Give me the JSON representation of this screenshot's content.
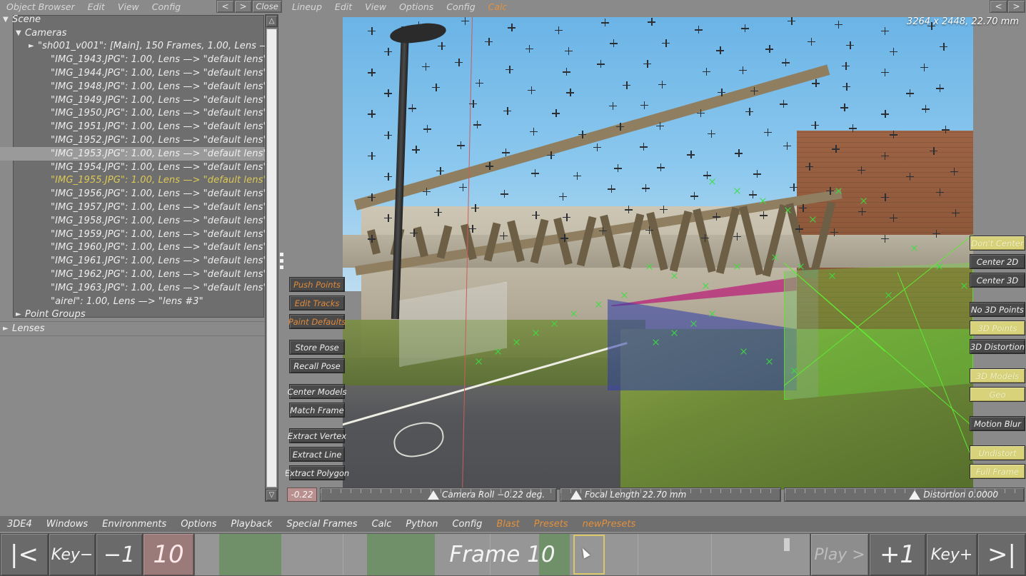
{
  "object_browser": {
    "menu": [
      "Object Browser",
      "Edit",
      "View",
      "Config"
    ],
    "nav_prev": "<",
    "nav_next": ">",
    "close_label": "Close",
    "tree": [
      {
        "label": "Scene",
        "indent": 0,
        "arrow": "down",
        "state": "normal"
      },
      {
        "label": "Cameras",
        "indent": 1,
        "arrow": "down",
        "state": "normal"
      },
      {
        "label": "\"sh001_v001\":  [Main], 150 Frames, 1.00, Lens —",
        "indent": 2,
        "arrow": "right",
        "state": "normal"
      },
      {
        "label": "\"IMG_1943.JPG\":  1.00, Lens —> \"default lens\"",
        "indent": 3,
        "arrow": "none",
        "state": "normal"
      },
      {
        "label": "\"IMG_1944.JPG\":  1.00, Lens —> \"default lens\"",
        "indent": 3,
        "arrow": "none",
        "state": "normal"
      },
      {
        "label": "\"IMG_1948.JPG\":  1.00, Lens —> \"default lens\"",
        "indent": 3,
        "arrow": "none",
        "state": "normal"
      },
      {
        "label": "\"IMG_1949.JPG\":  1.00, Lens —> \"default lens\"",
        "indent": 3,
        "arrow": "none",
        "state": "normal"
      },
      {
        "label": "\"IMG_1950.JPG\":  1.00, Lens —> \"default lens\"",
        "indent": 3,
        "arrow": "none",
        "state": "normal"
      },
      {
        "label": "\"IMG_1951.JPG\":  1.00, Lens —> \"default lens\"",
        "indent": 3,
        "arrow": "none",
        "state": "normal"
      },
      {
        "label": "\"IMG_1952.JPG\":  1.00, Lens —> \"default lens\"",
        "indent": 3,
        "arrow": "none",
        "state": "normal"
      },
      {
        "label": "\"IMG_1953.JPG\":  1.00, Lens —> \"default lens\"",
        "indent": 3,
        "arrow": "none",
        "state": "selected"
      },
      {
        "label": "\"IMG_1954.JPG\":  1.00, Lens —> \"default lens\"",
        "indent": 3,
        "arrow": "none",
        "state": "normal"
      },
      {
        "label": "\"IMG_1955.JPG\":  1.00, Lens —> \"default lens\"",
        "indent": 3,
        "arrow": "none",
        "state": "highlight"
      },
      {
        "label": "\"IMG_1956.JPG\":  1.00, Lens —> \"default lens\"",
        "indent": 3,
        "arrow": "none",
        "state": "normal"
      },
      {
        "label": "\"IMG_1957.JPG\":  1.00, Lens —> \"default lens\"",
        "indent": 3,
        "arrow": "none",
        "state": "normal"
      },
      {
        "label": "\"IMG_1958.JPG\":  1.00, Lens —> \"default lens\"",
        "indent": 3,
        "arrow": "none",
        "state": "normal"
      },
      {
        "label": "\"IMG_1959.JPG\":  1.00, Lens —> \"default lens\"",
        "indent": 3,
        "arrow": "none",
        "state": "normal"
      },
      {
        "label": "\"IMG_1960.JPG\":  1.00, Lens —> \"default lens\"",
        "indent": 3,
        "arrow": "none",
        "state": "normal"
      },
      {
        "label": "\"IMG_1961.JPG\":  1.00, Lens —> \"default lens\"",
        "indent": 3,
        "arrow": "none",
        "state": "normal"
      },
      {
        "label": "\"IMG_1962.JPG\":  1.00, Lens —> \"default lens\"",
        "indent": 3,
        "arrow": "none",
        "state": "normal"
      },
      {
        "label": "\"IMG_1963.JPG\":  1.00, Lens —> \"default lens\"",
        "indent": 3,
        "arrow": "none",
        "state": "normal"
      },
      {
        "label": "\"airel\":  1.00, Lens —> \"lens #3\"",
        "indent": 3,
        "arrow": "none",
        "state": "normal"
      },
      {
        "label": "Point Groups",
        "indent": 1,
        "arrow": "right",
        "state": "normal"
      },
      {
        "label": "Lenses",
        "indent": 0,
        "arrow": "right",
        "state": "normal"
      }
    ]
  },
  "viewport": {
    "menu": [
      "Lineup",
      "Edit",
      "View",
      "Options",
      "Config"
    ],
    "menu_accent": "Calc",
    "nav_prev": "<",
    "nav_next": ">",
    "resolution_label": "3264 x 2448, 22.70 mm",
    "left_tools": [
      {
        "label": "Push Points",
        "style": "orange"
      },
      {
        "label": "Edit Tracks",
        "style": "orange"
      },
      {
        "label": "Paint Defaults",
        "style": "orange"
      },
      {
        "label": "",
        "style": "gap"
      },
      {
        "label": "Store Pose",
        "style": "normal"
      },
      {
        "label": "Recall Pose",
        "style": "normal"
      },
      {
        "label": "",
        "style": "gap"
      },
      {
        "label": "Center Models",
        "style": "normal"
      },
      {
        "label": "Match Frame",
        "style": "normal"
      },
      {
        "label": "",
        "style": "gap"
      },
      {
        "label": "Extract Vertex",
        "style": "normal"
      },
      {
        "label": "Extract Line",
        "style": "normal"
      },
      {
        "label": "Extract Polygon",
        "style": "normal"
      }
    ],
    "right_tools": [
      {
        "label": "Don't Center",
        "style": "yellow"
      },
      {
        "label": "Center 2D",
        "style": "normal"
      },
      {
        "label": "Center 3D",
        "style": "normal"
      },
      {
        "label": "",
        "style": "gap"
      },
      {
        "label": "No 3D Points",
        "style": "normal"
      },
      {
        "label": "3D Points",
        "style": "yellow"
      },
      {
        "label": "3D Distortion",
        "style": "normal"
      },
      {
        "label": "",
        "style": "gap"
      },
      {
        "label": "3D Models",
        "style": "yellow"
      },
      {
        "label": "Geo",
        "style": "yellow"
      },
      {
        "label": "",
        "style": "gap"
      },
      {
        "label": "Motion Blur",
        "style": "normal"
      },
      {
        "label": "",
        "style": "gap"
      },
      {
        "label": "Undistort",
        "style": "yellow"
      },
      {
        "label": "Full Frame",
        "style": "yellow"
      }
    ],
    "sliders": {
      "roll_value": "-0.22",
      "roll_label": "Camera Roll −0.22 deg.",
      "focal_label": "Focal Length 22.70 mm",
      "distortion_label": "Distortion 0.0000"
    }
  },
  "bottom_menu": {
    "items": [
      "3DE4",
      "Windows",
      "Environments",
      "Options",
      "Playback",
      "Special Frames",
      "Calc",
      "Python",
      "Config"
    ],
    "accent_items": [
      "Blast",
      "Presets",
      "newPresets"
    ]
  },
  "playback": {
    "go_start": "|<",
    "key_prev": "Key−",
    "step_back": "−1",
    "current_frame": "10",
    "timeline_label": "Frame 10",
    "play": "Play >",
    "step_fwd": "+1",
    "key_next": "Key+",
    "go_end": ">|"
  },
  "colors": {
    "accent_orange": "#e2903c",
    "highlight_yellow": "#d8d37a",
    "tree_highlight": "#ddc954",
    "frame_box": "#9b7a7a",
    "track_green": "#39e03d"
  }
}
